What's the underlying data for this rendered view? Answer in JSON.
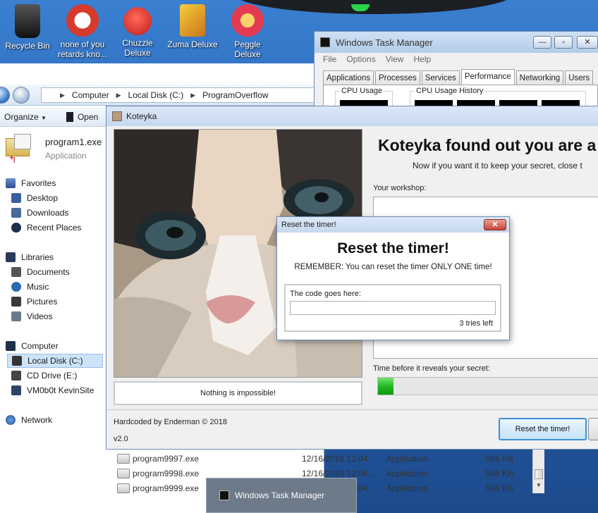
{
  "desktop": {
    "icons": [
      {
        "label": "Recycle Bin",
        "color": "#1c1c1c"
      },
      {
        "label": "none of you retards kno...",
        "color": "#d63a2a"
      },
      {
        "label": "Chuzzle Deluxe",
        "color": "#d22a2a"
      },
      {
        "label": "Zuma Deluxe",
        "color": "#e3a321"
      },
      {
        "label": "Peggle Deluxe",
        "color": "#e33a52"
      }
    ]
  },
  "explorer": {
    "breadcrumb": [
      "Computer",
      "Local Disk (C:)",
      "ProgramOverflow"
    ],
    "toolbar": {
      "organize": "Organize",
      "open": "Open"
    },
    "selected_file": {
      "name": "program1.exe",
      "type": "Application"
    },
    "favorites": {
      "header": "Favorites",
      "items": [
        "Desktop",
        "Downloads",
        "Recent Places"
      ]
    },
    "libraries": {
      "header": "Libraries",
      "items": [
        "Documents",
        "Music",
        "Pictures",
        "Videos"
      ]
    },
    "computer": {
      "header": "Computer",
      "items": [
        "Local Disk (C:)",
        "CD Drive (E:)",
        "VM0b0t KevinSite"
      ]
    },
    "network": "Network",
    "files": [
      {
        "name": "program9997.exe",
        "date": "12/16/2018 12:04 ...",
        "type": "Application",
        "size": "566 KB"
      },
      {
        "name": "program9998.exe",
        "date": "12/16/2018 12:04 ...",
        "type": "Application",
        "size": "566 KB"
      },
      {
        "name": "program9999.exe",
        "date": "12/16/2018 12:04 ...",
        "type": "Application",
        "size": "566 KB"
      }
    ]
  },
  "taskmanager": {
    "title": "Windows Task Manager",
    "menu": [
      "File",
      "Options",
      "View",
      "Help"
    ],
    "tabs": [
      "Applications",
      "Processes",
      "Services",
      "Performance",
      "Networking",
      "Users"
    ],
    "active_tab": "Performance",
    "cpu_usage": "CPU Usage",
    "cpu_history": "CPU Usage History"
  },
  "koteyka": {
    "title": "Koteyka",
    "heading": "Koteyka found out you are a",
    "subtitle": "Now if you want it to keep your secret, close t",
    "workshop_label": "Your workshop:",
    "timer_label": "Time before it reveals your secret:",
    "timer_progress": 0.07,
    "motto": "Nothing is impossible!",
    "credit": "Hardcoded by Enderman © 2018",
    "version": "v2.0",
    "reset_button": "Reset the timer!",
    "accent_color": "#3c8fd8",
    "progress_color": "#1fb51f"
  },
  "reset_dialog": {
    "title": "Reset the timer!",
    "heading": "Reset the timer!",
    "reminder": "REMEMBER: You can reset the timer ONLY ONE time!",
    "code_label": "The code goes here:",
    "code_value": "",
    "tries_left": "3  tries left",
    "close_glyph": "✕"
  },
  "taskbar_popup": {
    "label": "Windows Task Manager"
  }
}
